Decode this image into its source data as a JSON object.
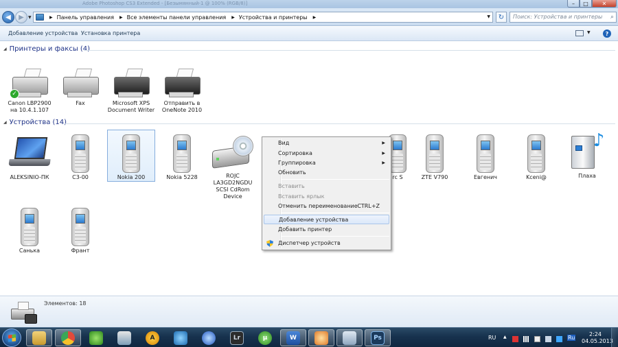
{
  "window": {
    "title": "Adobe Photoshop CS3 Extended - [Безымянный-1 @ 100% (RGB/8)]",
    "min_glyph": "–",
    "max_glyph": "□",
    "close_glyph": "✕"
  },
  "address": {
    "crumbs": [
      "Панель управления",
      "Все элементы панели управления",
      "Устройства и принтеры"
    ],
    "search_placeholder": "Поиск: Устройства и принтеры"
  },
  "commands": {
    "add_device": "Добавление устройства",
    "install_printer": "Установка принтера"
  },
  "printers_group": {
    "title": "Принтеры и факсы (4)",
    "items": [
      {
        "label_lines": [
          "Canon LBP2900",
          "на 10.4.1.107"
        ],
        "icon": "laser-printer-icon",
        "default": true
      },
      {
        "label_lines": [
          "Fax"
        ],
        "icon": "fax-icon"
      },
      {
        "label_lines": [
          "Microsoft XPS",
          "Document Writer"
        ],
        "icon": "printer-icon"
      },
      {
        "label_lines": [
          "Отправить в",
          "OneNote 2010"
        ],
        "icon": "printer-icon"
      }
    ]
  },
  "devices_group": {
    "title": "Устройства (14)",
    "items": [
      {
        "label_lines": [
          "ALEKSINIO-ПК"
        ],
        "icon": "laptop-icon"
      },
      {
        "label_lines": [
          "C3-00"
        ],
        "icon": "phone-icon"
      },
      {
        "label_lines": [
          "Nokia 200"
        ],
        "icon": "phone-icon",
        "selected": true
      },
      {
        "label_lines": [
          "Nokia 5228"
        ],
        "icon": "phone-icon"
      },
      {
        "label_lines": [
          "ROJC",
          "LA3GD2NGDU",
          "SCSI CdRom",
          "Device"
        ],
        "icon": "cdrom-icon"
      },
      {
        "label_lines": [
          "rc S"
        ],
        "icon": "phone-icon"
      },
      {
        "label_lines": [
          "ZTE V790"
        ],
        "icon": "phone-icon"
      },
      {
        "label_lines": [
          "Евгенич"
        ],
        "icon": "phone-icon"
      },
      {
        "label_lines": [
          "Kceni@"
        ],
        "icon": "phone-icon"
      },
      {
        "label_lines": [
          "Плаха"
        ],
        "icon": "media-device-icon"
      },
      {
        "label_lines": [
          "Санька"
        ],
        "icon": "phone-icon"
      },
      {
        "label_lines": [
          "Франт"
        ],
        "icon": "phone-icon"
      }
    ]
  },
  "context_menu": {
    "items": [
      {
        "label": "Вид",
        "submenu": true
      },
      {
        "label": "Сортировка",
        "submenu": true
      },
      {
        "label": "Группировка",
        "submenu": true
      },
      {
        "label": "Обновить"
      },
      {
        "label": "Вставить",
        "disabled": true
      },
      {
        "label": "Вставить ярлык",
        "disabled": true
      },
      {
        "label": "Отменить переименование",
        "shortcut": "CTRL+Z"
      },
      {
        "label": "Добавление устройства",
        "highlighted": true
      },
      {
        "label": "Добавить принтер"
      },
      {
        "label": "Диспетчер устройств",
        "icon": "shield-icon"
      }
    ]
  },
  "details": {
    "count_text": "Элементов: 18"
  },
  "taskbar": {
    "buttons": [
      "explorer",
      "chrome",
      "butterfly",
      "network",
      "aimp",
      "media",
      "globe",
      "lightroom",
      "utorrent",
      "word",
      "paint",
      "devices",
      "photoshop"
    ],
    "labels": {
      "lightroom": "Lr",
      "word": "W",
      "photoshop": "Ps"
    },
    "lang": "RU",
    "tray_lang": "Ru",
    "time": "2:24",
    "date": "04.05.2013"
  },
  "colors": {
    "accent": "#1e3287",
    "selection": "#84acdd",
    "taskbar": "#17324e"
  }
}
